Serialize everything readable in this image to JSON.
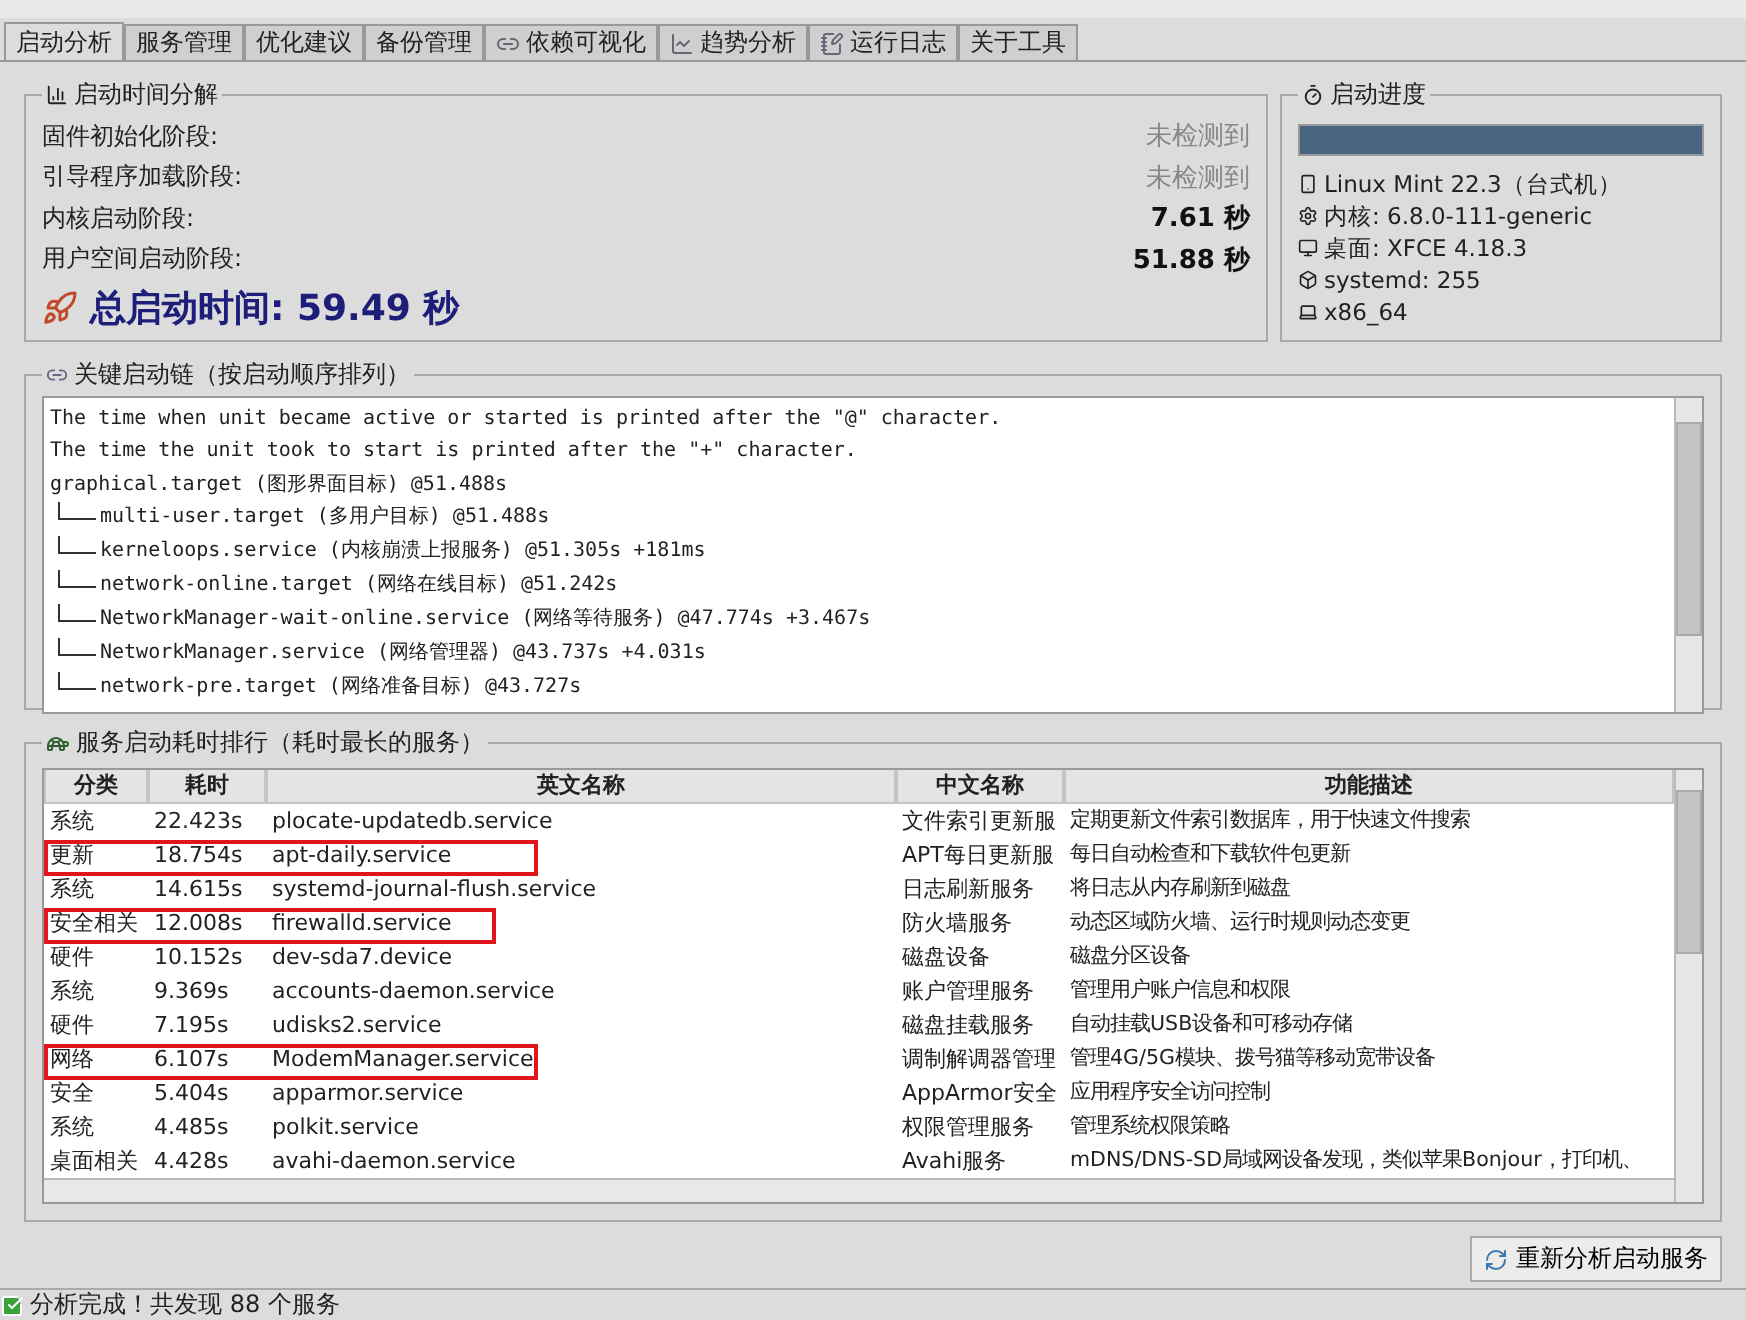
{
  "tabs": [
    {
      "label": "启动分析",
      "selected": true
    },
    {
      "label": "服务管理",
      "selected": false
    },
    {
      "label": "优化建议",
      "selected": false
    },
    {
      "label": "备份管理",
      "selected": false
    },
    {
      "label": "依赖可视化",
      "selected": false
    },
    {
      "label": "趋势分析",
      "selected": false
    },
    {
      "label": "运行日志",
      "selected": false
    },
    {
      "label": "关于工具",
      "selected": false
    }
  ],
  "breakdown": {
    "title": "启动时间分解",
    "stages": [
      {
        "label": "固件初始化阶段:",
        "value": "未检测到",
        "detected": false
      },
      {
        "label": "引导程序加载阶段:",
        "value": "未检测到",
        "detected": false
      },
      {
        "label": "内核启动阶段:",
        "value": "7.61 秒",
        "detected": true
      },
      {
        "label": "用户空间启动阶段:",
        "value": "51.88 秒",
        "detected": true
      }
    ],
    "total": "总启动时间: 59.49 秒"
  },
  "progress": {
    "title": "启动进度",
    "level": 1,
    "info": [
      "Linux Mint 22.3（台式机）",
      "内核: 6.8.0-111-generic",
      "桌面: XFCE 4.18.3",
      "systemd: 255",
      "x86_64"
    ]
  },
  "chain": {
    "title": "关键启动链（按启动顺序排列）",
    "header": [
      "The time when unit became active or started is printed after the \"@\" character.",
      "The time the unit took to start is printed after the \"+\" character."
    ],
    "root": {
      "label": "graphical.target (图形界面目标) @51.488s",
      "children": [
        {
          "label": "multi-user.target (多用户目标) @51.488s"
        },
        {
          "label": "kerneloops.service (内核崩溃上报服务) @51.305s +181ms"
        },
        {
          "label": "network-online.target (网络在线目标) @51.242s"
        },
        {
          "label": "NetworkManager-wait-online.service (网络等待服务) @47.774s +3.467s"
        },
        {
          "label": "NetworkManager.service (网络管理器) @43.737s +4.031s"
        },
        {
          "label": "network-pre.target (网络准备目标) @43.727s"
        }
      ]
    }
  },
  "ranking": {
    "title": "服务启动耗时排行（耗时最长的服务）",
    "columns": [
      "分类",
      "耗时",
      "英文名称",
      "中文名称",
      "功能描述"
    ],
    "rows": [
      {
        "cells": [
          "系统",
          "22.423s",
          "plocate-updatedb.service",
          "文件索引更新服",
          "定期更新文件索引数据库，用于快速文件搜索"
        ],
        "highlighted": false
      },
      {
        "cells": [
          "更新",
          "18.754s",
          "apt-daily.service",
          "APT每日更新服",
          "每日自动检查和下载软件包更新"
        ],
        "highlighted": true
      },
      {
        "cells": [
          "系统",
          "14.615s",
          "systemd-journal-flush.service",
          "日志刷新服务",
          "将日志从内存刷新到磁盘"
        ],
        "highlighted": false
      },
      {
        "cells": [
          "安全相关",
          "12.008s",
          "firewalld.service",
          "防火墙服务",
          "动态区域防火墙、运行时规则动态变更"
        ],
        "highlighted": true
      },
      {
        "cells": [
          "硬件",
          "10.152s",
          "dev-sda7.device",
          "磁盘设备",
          "磁盘分区设备"
        ],
        "highlighted": false
      },
      {
        "cells": [
          "系统",
          "9.369s",
          "accounts-daemon.service",
          "账户管理服务",
          "管理用户账户信息和权限"
        ],
        "highlighted": false
      },
      {
        "cells": [
          "硬件",
          "7.195s",
          "udisks2.service",
          "磁盘挂载服务",
          "自动挂载USB设备和可移动存储"
        ],
        "highlighted": false
      },
      {
        "cells": [
          "网络",
          "6.107s",
          "ModemManager.service",
          "调制解调器管理",
          "管理4G/5G模块、拨号猫等移动宽带设备"
        ],
        "highlighted": true
      },
      {
        "cells": [
          "安全",
          "5.404s",
          "apparmor.service",
          "AppArmor安全",
          "应用程序安全访问控制"
        ],
        "highlighted": false
      },
      {
        "cells": [
          "系统",
          "4.485s",
          "polkit.service",
          "权限管理服务",
          "管理系统权限策略"
        ],
        "highlighted": false
      },
      {
        "cells": [
          "桌面相关",
          "4.428s",
          "avahi-daemon.service",
          "Avahi服务",
          "mDNS/DNS-SD局域网设备发现，类似苹果Bonjour，打印机、"
        ],
        "highlighted": false
      }
    ]
  },
  "reanalyze_button": "重新分析启动服务",
  "status_bar": "分析完成！共发现 88 个服务"
}
